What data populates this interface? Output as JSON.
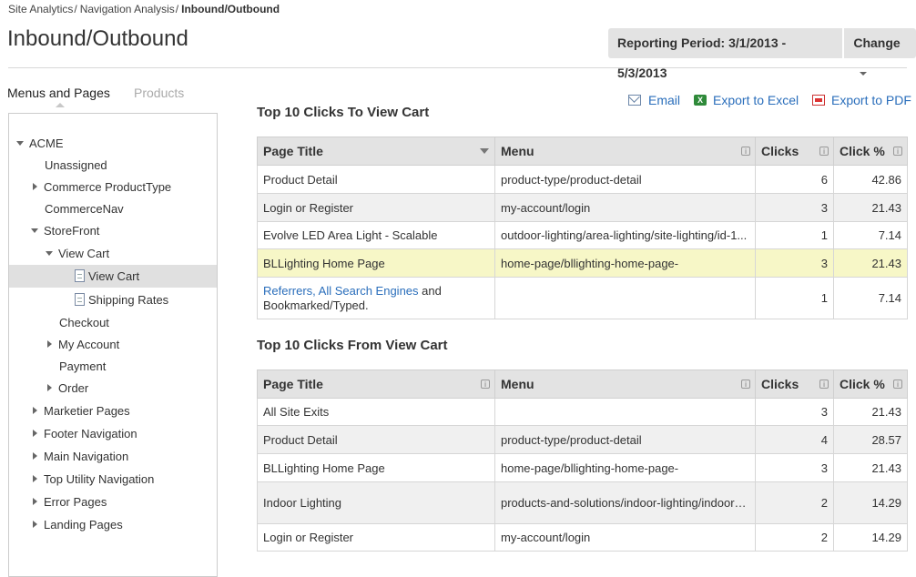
{
  "breadcrumb": {
    "items": [
      "Site Analytics",
      "Navigation Analysis"
    ],
    "separator": "/",
    "current": "Inbound/Outbound"
  },
  "page_title": "Inbound/Outbound",
  "reporting_period": {
    "label": "Reporting Period: 3/1/2013 - 5/3/2013",
    "change_label": "Change"
  },
  "side_tabs": {
    "active": "Menus and Pages",
    "inactive": "Products"
  },
  "tree": [
    {
      "label": "ACME",
      "arrow": "down"
    },
    {
      "label": "Unassigned",
      "arrow": ""
    },
    {
      "label": "Commerce ProductType",
      "arrow": "right"
    },
    {
      "label": "CommerceNav",
      "arrow": ""
    },
    {
      "label": "StoreFront",
      "arrow": "down"
    },
    {
      "label": "View Cart",
      "arrow": "down"
    },
    {
      "label": "View Cart",
      "arrow": "",
      "doc": true,
      "selected": true
    },
    {
      "label": "Shipping Rates",
      "arrow": "",
      "doc": true
    },
    {
      "label": "Checkout",
      "arrow": ""
    },
    {
      "label": "My Account",
      "arrow": "right"
    },
    {
      "label": "Payment",
      "arrow": ""
    },
    {
      "label": "Order",
      "arrow": "right"
    },
    {
      "label": "Marketier Pages",
      "arrow": "right"
    },
    {
      "label": "Footer Navigation",
      "arrow": "right"
    },
    {
      "label": "Main Navigation",
      "arrow": "right"
    },
    {
      "label": "Top Utility Navigation",
      "arrow": "right"
    },
    {
      "label": "Error Pages",
      "arrow": "right"
    },
    {
      "label": "Landing Pages",
      "arrow": "right"
    }
  ],
  "exports": {
    "email": "Email",
    "excel": "Export to Excel",
    "pdf": "Export to PDF",
    "excel_icon_text": "X"
  },
  "table_to": {
    "title": "Top 10 Clicks To View Cart",
    "headers": {
      "page_title": "Page Title",
      "menu": "Menu",
      "clicks": "Clicks",
      "click_pct": "Click %"
    },
    "rows": [
      {
        "page_title": "Product Detail",
        "menu": "product-type/product-detail",
        "clicks": "6",
        "click_pct": "42.86"
      },
      {
        "page_title": "Login or Register",
        "menu": "my-account/login",
        "clicks": "3",
        "click_pct": "21.43"
      },
      {
        "page_title": "Evolve LED Area Light - Scalable",
        "menu": "outdoor-lighting/area-lighting/site-lighting/id-1...",
        "clicks": "1",
        "click_pct": "7.14"
      },
      {
        "page_title": "BLLighting Home Page",
        "menu": "home-page/bllighting-home-page-",
        "clicks": "3",
        "click_pct": "21.43"
      }
    ],
    "referrers": {
      "link": "Referrers, All Search Engines",
      "text_after": " and",
      "line2": "Bookmarked/Typed.",
      "clicks": "1",
      "click_pct": "7.14"
    }
  },
  "table_from": {
    "title": "Top 10 Clicks From View Cart",
    "headers": {
      "page_title": "Page Title",
      "menu": "Menu",
      "clicks": "Clicks",
      "click_pct": "Click %"
    },
    "rows": [
      {
        "page_title": "All Site Exits",
        "menu": "",
        "clicks": "3",
        "click_pct": "21.43"
      },
      {
        "page_title": "Product Detail",
        "menu": "product-type/product-detail",
        "clicks": "4",
        "click_pct": "28.57"
      },
      {
        "page_title": "BLLighting Home Page",
        "menu": "home-page/bllighting-home-page-",
        "clicks": "3",
        "click_pct": "21.43"
      },
      {
        "page_title": "Indoor Lighting",
        "menu": "products-and-solutions/indoor-lighting/indoor-lighting",
        "clicks": "2",
        "click_pct": "14.29"
      },
      {
        "page_title": "Login or Register",
        "menu": "my-account/login",
        "clicks": "2",
        "click_pct": "14.29"
      }
    ]
  },
  "info_icon_text": "i"
}
